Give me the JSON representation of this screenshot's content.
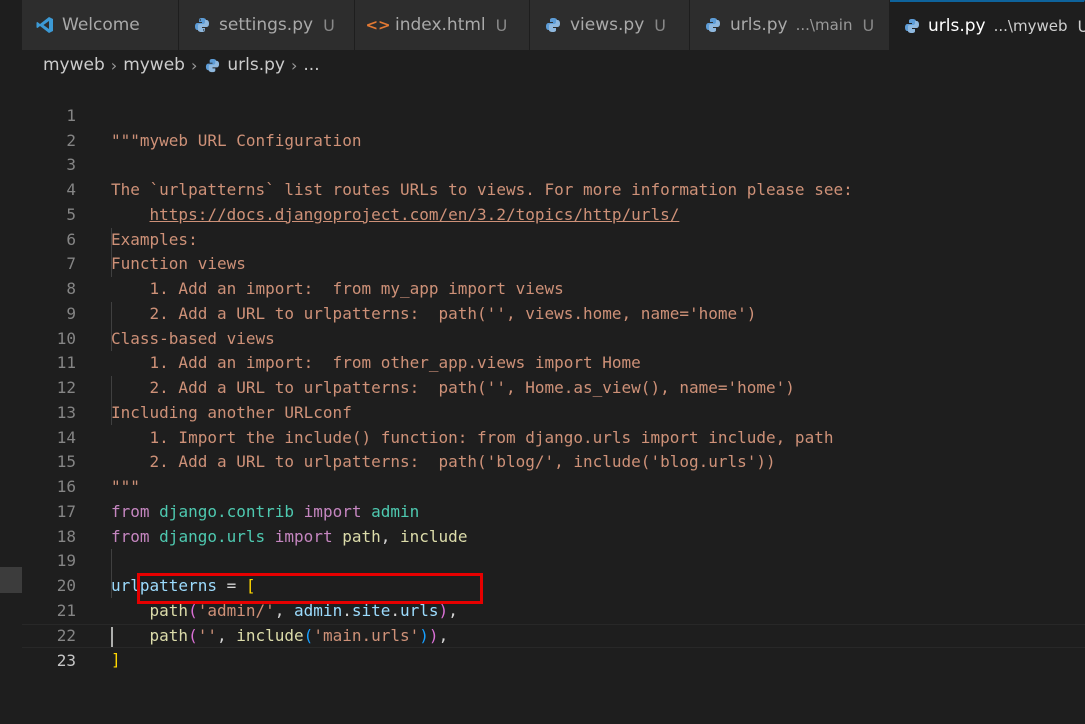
{
  "tabs": [
    {
      "label": "Welcome",
      "icon": "vscode-icon",
      "modified": "",
      "path": ""
    },
    {
      "label": "settings.py",
      "icon": "python-file-icon",
      "modified": "U",
      "path": ""
    },
    {
      "label": "index.html",
      "icon": "html-file-icon",
      "modified": "U",
      "path": ""
    },
    {
      "label": "views.py",
      "icon": "python-file-icon",
      "modified": "U",
      "path": ""
    },
    {
      "label": "urls.py",
      "icon": "python-file-icon",
      "modified": "U",
      "path": "...\\main"
    },
    {
      "label": "urls.py",
      "icon": "python-file-icon",
      "modified": "U",
      "path": "...\\myweb",
      "active": true
    }
  ],
  "breadcrumb": [
    "myweb",
    "myweb",
    "urls.py",
    "..."
  ],
  "editor": {
    "current_line": "23",
    "highlighted_line": "21",
    "lines": [
      [
        "1",
        "\"\"\"myweb URL Configuration"
      ],
      [
        "2",
        ""
      ],
      [
        "3",
        "The `urlpatterns` list routes URLs to views. For more information please see:"
      ],
      [
        "4",
        "    https://docs.djangoproject.com/en/3.2/topics/http/urls/"
      ],
      [
        "5",
        "Examples:"
      ],
      [
        "6",
        "Function views"
      ],
      [
        "7",
        "    1. Add an import:  from my_app import views"
      ],
      [
        "8",
        "    2. Add a URL to urlpatterns:  path('', views.home, name='home')"
      ],
      [
        "9",
        "Class-based views"
      ],
      [
        "10",
        "    1. Add an import:  from other_app.views import Home"
      ],
      [
        "11",
        "    2. Add a URL to urlpatterns:  path('', Home.as_view(), name='home')"
      ],
      [
        "12",
        "Including another URLconf"
      ],
      [
        "13",
        "    1. Import the include() function: from django.urls import include, path"
      ],
      [
        "14",
        "    2. Add a URL to urlpatterns:  path('blog/', include('blog.urls'))"
      ],
      [
        "15",
        "\"\"\""
      ],
      [
        "16",
        "from django.contrib import admin"
      ],
      [
        "17",
        "from django.urls import path, include"
      ],
      [
        "18",
        ""
      ],
      [
        "19",
        "urlpatterns = ["
      ],
      [
        "20",
        "    path('admin/', admin.site.urls),"
      ],
      [
        "21",
        "    path('', include('main.urls')),"
      ],
      [
        "22",
        "]"
      ],
      [
        "23",
        ""
      ]
    ]
  },
  "colors": {
    "accent": "#0e639c",
    "highlight_box": "#e60000",
    "string": "#ce9178",
    "keyword": "#c586c0"
  }
}
